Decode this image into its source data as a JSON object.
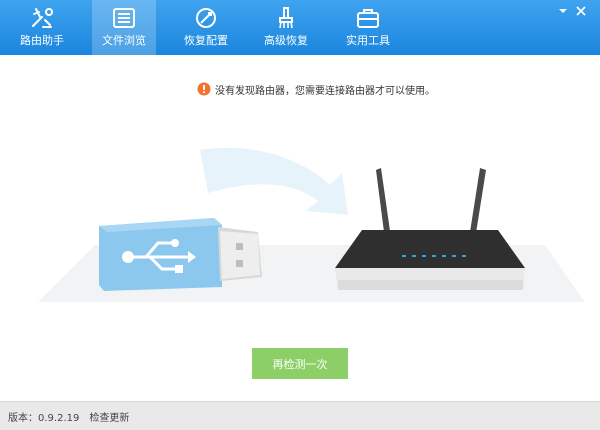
{
  "tabs": [
    {
      "label": "路由助手",
      "icon": "router-tools-icon",
      "active": false
    },
    {
      "label": "文件浏览",
      "icon": "file-browser-icon",
      "active": true
    },
    {
      "label": "恢复配置",
      "icon": "restore-config-icon",
      "active": false
    },
    {
      "label": "高级恢复",
      "icon": "brush-icon",
      "active": false
    },
    {
      "label": "实用工具",
      "icon": "toolbox-icon",
      "active": false
    }
  ],
  "window_controls": {
    "minimize_icon": "minimize-icon",
    "close_icon": "close-icon"
  },
  "notice": {
    "icon": "warning-icon",
    "text": "没有发现路由器，您需要连接路由器才可以使用。"
  },
  "illustration": {
    "usb_icon": "usb-drive-icon",
    "router_icon": "router-icon",
    "arrow_icon": "curved-arrow-icon"
  },
  "retry_button": {
    "label": "再检测一次"
  },
  "footer": {
    "version": "版本：0.9.2.19",
    "check_update": "检查更新"
  },
  "colors": {
    "topbar": "#2593e6",
    "accent_green": "#8bcf66",
    "usb_blue": "#8cc8ee",
    "router_dark": "#3a3a3a",
    "warning": "#f0732e"
  }
}
